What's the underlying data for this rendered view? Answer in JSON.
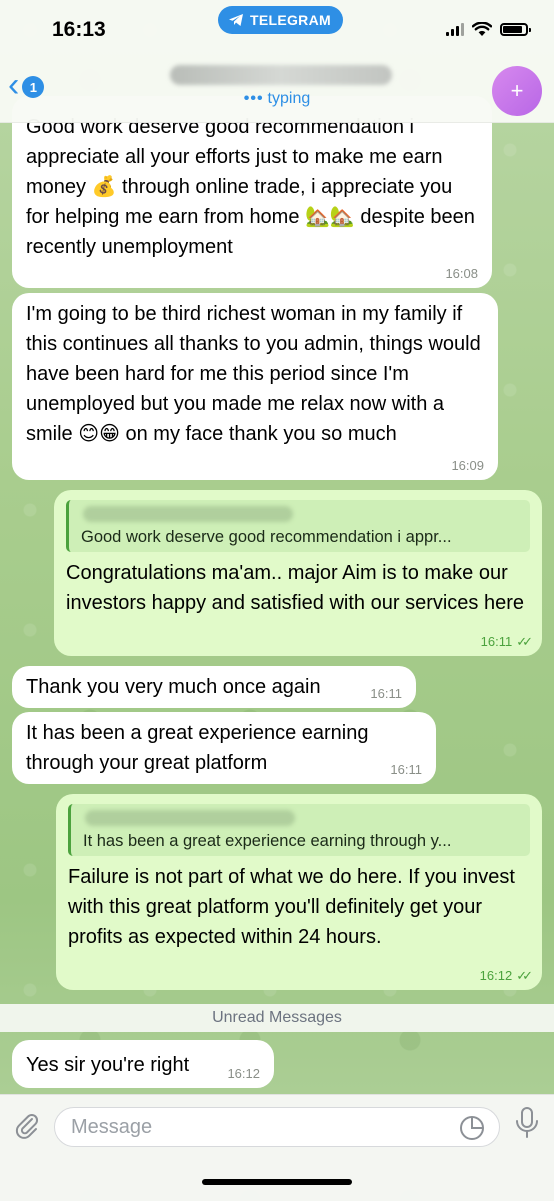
{
  "status_bar": {
    "time": "16:13",
    "app_pill": "TELEGRAM"
  },
  "header": {
    "back_badge": "1",
    "status": "typing",
    "avatar_symbol": "+"
  },
  "messages": [
    {
      "direction": "incoming",
      "text": "Good work deserve good recommendation i appreciate all your efforts just to make me earn money 💰 through online trade, i appreciate you for helping me earn from home 🏡🏡 despite been recently unemployment",
      "time": "16:08"
    },
    {
      "direction": "incoming",
      "text": "I'm going to be third richest woman in my family if this continues all thanks to you admin, things would have been hard for me this period since I'm unemployed but you made me relax now with a smile 😊😁 on my face thank you so much",
      "time": "16:09"
    },
    {
      "direction": "outgoing",
      "quote": "Good work deserve good recommendation i appr...",
      "text": "Congratulations ma'am.. major Aim is to make our investors happy and satisfied with our services here",
      "time": "16:11",
      "read": true
    },
    {
      "direction": "incoming",
      "text": "Thank you very much once again",
      "time": "16:11"
    },
    {
      "direction": "incoming",
      "text": "It has been a great experience earning through your great platform",
      "time": "16:11"
    },
    {
      "direction": "outgoing",
      "quote": "It has been a great experience earning through y...",
      "text": "Failure is not part of what we do here. If you invest with this great platform you'll definitely get your profits as expected within 24 hours.",
      "time": "16:12",
      "read": true
    },
    {
      "direction": "incoming",
      "text": "Yes sir you're right",
      "time": "16:12"
    }
  ],
  "unread_banner": "Unread Messages",
  "input": {
    "placeholder": "Message"
  },
  "colors": {
    "accent": "#2e8fe5",
    "outgoing_bubble": "#e1fac9",
    "incoming_bubble": "#ffffff",
    "read_check": "#4ba23d",
    "avatar": "#c879ea"
  }
}
